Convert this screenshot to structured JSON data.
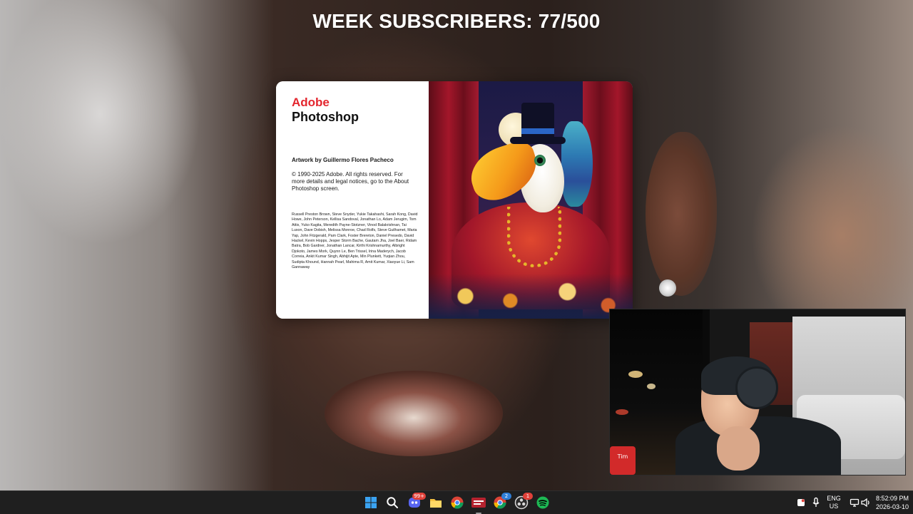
{
  "overlay": {
    "title": "WEEK SUBSCRIBERS: 77/500"
  },
  "splash": {
    "brand_top": "Adobe",
    "brand_bottom": "Photoshop",
    "artwork_credit": "Artwork by Guillermo Flores Pacheco",
    "legal": "© 1990-2025 Adobe. All rights reserved. For more details and legal notices, go to the About Photoshop screen.",
    "contributors": "Russell Preston Brown, Steve Snyder, Yukie Takahashi, Sarah Kong, David Howe, John Peterson, Kellisa Sandoval, Jonathan Lo, Adam Jerugim, Tom Attix, Yuko Kagita, Meredith Payne-Stotzner, Vinod Balakrishnan, Tai Luxon, Dave Dobish, Melissa Monroe, Chad Rolfs, Steve Guilhamet, Maria Yap, John Fitzgerald, Pam Clark, Foster Brereton, Daniel Presedo, David Hackel, Kevin Hopps, Jesper Storm Bache, Gautam Jha, Joel Baer, Ridam Batra, Bob Gardner, Jonathan Lancar, Kirthi Krishnamurthy, Albright Djokoto, James Mork, Quynn Le, Ben Trissel, Irina Maderych, Jacob Correia, Ankit Kumar Singh, Abhijit Apte, Min Plunkett, Yuqian Zhou, Sudipta Khound, Hannah Pearl, Mahima R, Amit Kumar, Xiaoyue Li, Sam Gannaway"
  },
  "webcam": {
    "cup_text": "Tim"
  },
  "taskbar": {
    "icons": [
      {
        "name": "windows-start-icon"
      },
      {
        "name": "search-icon"
      },
      {
        "name": "discord-icon",
        "badge": "99+"
      },
      {
        "name": "file-explorer-icon"
      },
      {
        "name": "chrome-icon"
      },
      {
        "name": "voicemod-icon"
      },
      {
        "name": "chrome-profile-icon",
        "badge": "2"
      },
      {
        "name": "obs-icon",
        "badge": "1"
      },
      {
        "name": "spotify-icon"
      }
    ],
    "tray": {
      "language_top": "ENG",
      "language_bottom": "US",
      "time": "8:52:09 PM",
      "date": "2026-03-10"
    }
  }
}
